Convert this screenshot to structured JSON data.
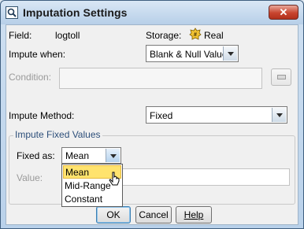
{
  "window": {
    "title": "Imputation Settings",
    "close_glyph": "✕"
  },
  "field": {
    "label": "Field:",
    "value": "logtoll"
  },
  "storage": {
    "label": "Storage:",
    "value": "Real",
    "icon": "real-number-icon"
  },
  "impute_when": {
    "label": "Impute when:",
    "value": "Blank & Null Values"
  },
  "condition": {
    "label": "Condition:",
    "value": ""
  },
  "impute_method": {
    "label": "Impute Method:",
    "value": "Fixed"
  },
  "group": {
    "title": "Impute Fixed Values",
    "fixed_as_label": "Fixed as:",
    "fixed_as_value": "Mean",
    "value_label": "Value:",
    "value": ""
  },
  "fixed_as_options": [
    "Mean",
    "Mid-Range",
    "Constant"
  ],
  "buttons": {
    "ok": "OK",
    "cancel": "Cancel",
    "help": "Help"
  }
}
